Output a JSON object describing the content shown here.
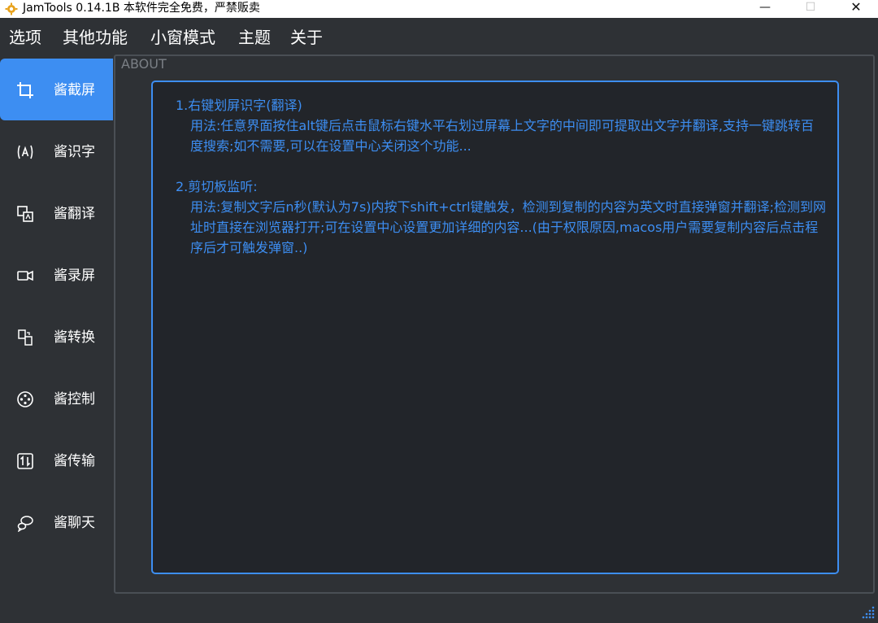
{
  "window": {
    "title": "JamTools 0.14.1B 本软件完全免费，严禁贩卖",
    "min_symbol": "—",
    "max_symbol": "☐",
    "close_symbol": "✕"
  },
  "menu": [
    "选项",
    "其他功能",
    "小窗模式",
    "主题",
    "关于"
  ],
  "sidebar": {
    "items": [
      {
        "label": "酱截屏",
        "icon": "crop-icon",
        "active": true
      },
      {
        "label": "酱识字",
        "icon": "text-scan-icon",
        "active": false
      },
      {
        "label": "酱翻译",
        "icon": "translate-icon",
        "active": false
      },
      {
        "label": "酱录屏",
        "icon": "video-camera-icon",
        "active": false
      },
      {
        "label": "酱转换",
        "icon": "file-convert-icon",
        "active": false
      },
      {
        "label": "酱控制",
        "icon": "control-icon",
        "active": false
      },
      {
        "label": "酱传输",
        "icon": "transfer-icon",
        "active": false
      },
      {
        "label": "酱聊天",
        "icon": "chat-icon",
        "active": false
      }
    ]
  },
  "about": {
    "group_title": "ABOUT",
    "section1_title": "1.右键划屏识字(翻译)",
    "section1_body": "用法:任意界面按住alt键后点击鼠标右键水平右划过屏幕上文字的中间即可提取出文字并翻译,支持一键跳转百度搜索;如不需要,可以在设置中心关闭这个功能...",
    "section2_title": "2.剪切板监听:",
    "section2_body": "用法:复制文字后n秒(默认为7s)内按下shift+ctrl键触发，检测到复制的内容为英文时直接弹窗并翻译;检测到网址时直接在浏览器打开;可在设置中心设置更加详细的内容...(由于权限原因,macos用户需要复制内容后点击程序后才可触发弹窗..)"
  },
  "colors": {
    "accent": "#3d8ef2",
    "background": "#2e3135",
    "content_background": "#22252a"
  }
}
